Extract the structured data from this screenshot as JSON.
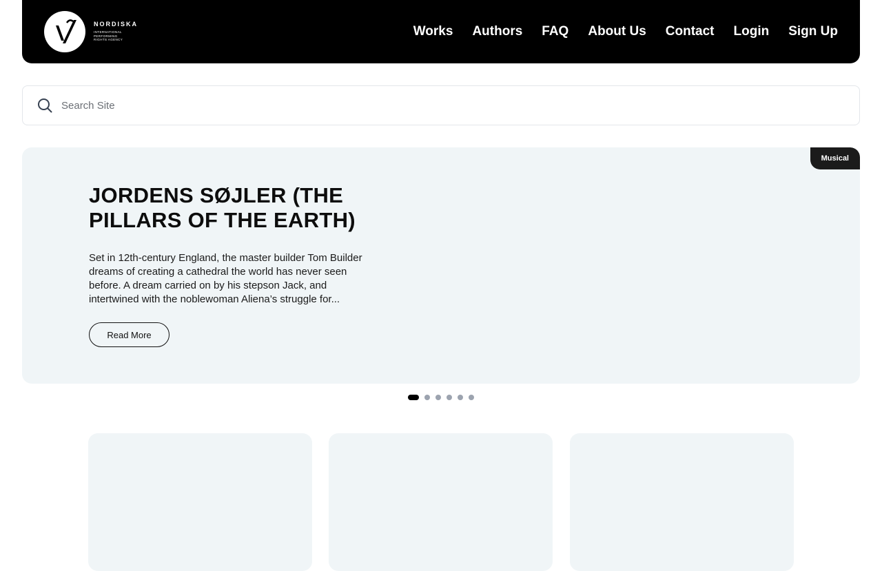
{
  "brand": {
    "name": "NORDISKA",
    "sub": "International Performing Rights Agency"
  },
  "nav": {
    "works": "Works",
    "authors": "Authors",
    "faq": "FAQ",
    "about": "About Us",
    "contact": "Contact",
    "login": "Login",
    "signup": "Sign Up"
  },
  "search": {
    "placeholder": "Search Site",
    "icon": "search-icon"
  },
  "hero": {
    "badge": "Musical",
    "title": "JORDENS SØJLER (THE PILLARS OF THE EARTH)",
    "description": "Set in 12th-century England, the master builder Tom Builder dreams of creating a cathedral the world has never seen before. A dream carried on by his stepson Jack, and intertwined with the noblewoman Aliena’s struggle for...",
    "button": "Read More"
  },
  "carousel": {
    "total_slides": 6,
    "active_slide": 1
  },
  "colors": {
    "header_bg": "#000000",
    "hero_bg": "#f0f5f7",
    "badge_bg": "#1b1b1b",
    "dot_inactive": "#9ca3af",
    "dot_active": "#000000"
  }
}
